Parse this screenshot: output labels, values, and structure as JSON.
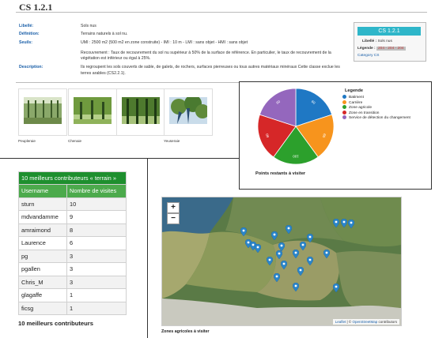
{
  "header": {
    "title": "CS 1.2.1"
  },
  "details": {
    "libelle_label": "Libellé:",
    "libelle_value": "Sols nus",
    "definition_label": "Définition:",
    "definition_value": "Terrains naturels à sol nu.",
    "seuils_label": "Seuils:",
    "seuils_line1": "UMI : 2500 m2 (500 m2 en zone construite) - IMI : 10 m - LMI : sans objet - HMI : sans objet",
    "seuils_line2": "Recouvrement : Taux de recouvrement du sol nu supérieur à 50% de la surface de référence. En particulier, le taux de recouvrement de la végétation est inférieur ou égal à 25%.",
    "description_label": "Description:",
    "description_value": "Ils regroupent les sols couverts de sable, de galets, de rochers, surfaces pierreuses ou tous autres matériaux minéraux Cette classe exclue les terres arables (CS2.2.1)."
  },
  "side_card": {
    "code": "CS 1.2.1",
    "libelle_label": "Libellé :",
    "libelle_value": "Sols nus",
    "legende_label": "Légende :",
    "legende_value": "204 - 204 - 204",
    "category_link": "Category CS"
  },
  "photos": [
    {
      "caption": "Peupleraie",
      "palette": [
        "#3c5a28",
        "#8aa86a",
        "#d9e4c8"
      ]
    },
    {
      "caption": "Chenaie",
      "palette": [
        "#2c4a1e",
        "#6f9a3e",
        "#b5d08a"
      ]
    },
    {
      "caption": "",
      "palette": [
        "#1e3a14",
        "#4e7a2e",
        "#a6c27a"
      ]
    },
    {
      "caption": "Yeuseraie",
      "palette": [
        "#2a4c70",
        "#5f8a3a",
        "#c9dcea"
      ]
    }
  ],
  "pie_card": {
    "legend_title": "Legende",
    "caption": "Points restants à visiter",
    "slices": [
      {
        "label": "Batiment",
        "value": 60,
        "color": "#1f78c4"
      },
      {
        "label": "Carrière",
        "value": 60,
        "color": "#f7941d"
      },
      {
        "label": "Zone agricole",
        "value": 60,
        "color": "#2ca02c"
      },
      {
        "label": "Zone en transition",
        "value": 60,
        "color": "#d62728"
      },
      {
        "label": "Service de détection du changement",
        "value": 60,
        "color": "#9467bd"
      }
    ],
    "slice_labels": [
      "60",
      "60",
      "100",
      "60",
      "60"
    ]
  },
  "contributors": {
    "caption": "10 meilleurs contributeurs « terrain »",
    "col_user": "Username",
    "col_visits": "Nombre de visites",
    "rows": [
      {
        "user": "sturn",
        "visits": "10"
      },
      {
        "user": "mdvandamme",
        "visits": "9"
      },
      {
        "user": "amraimond",
        "visits": "8"
      },
      {
        "user": "Laurence",
        "visits": "6"
      },
      {
        "user": "pg",
        "visits": "3"
      },
      {
        "user": "pgallen",
        "visits": "3"
      },
      {
        "user": "Chris_M",
        "visits": "3"
      },
      {
        "user": "glagaffe",
        "visits": "1"
      },
      {
        "user": "ficsg",
        "visits": "1"
      }
    ],
    "footer": "10 meilleurs contributeurs"
  },
  "map": {
    "zoom_in": "+",
    "zoom_out": "−",
    "attrib_link1": "Leaflet",
    "attrib_sep": " | © ",
    "attrib_link2": "OpenStreetMap",
    "attrib_tail": " contributors",
    "caption": "Zones agricoles à visiter",
    "marker_icon": "map-pin-icon",
    "markers": [
      {
        "lon": 0.62,
        "lat": 0.52
      },
      {
        "lon": 0.34,
        "lat": 0.29
      },
      {
        "lon": 0.36,
        "lat": 0.38
      },
      {
        "lon": 0.38,
        "lat": 0.4
      },
      {
        "lon": 0.4,
        "lat": 0.42
      },
      {
        "lon": 0.47,
        "lat": 0.32
      },
      {
        "lon": 0.53,
        "lat": 0.27
      },
      {
        "lon": 0.5,
        "lat": 0.41
      },
      {
        "lon": 0.49,
        "lat": 0.47
      },
      {
        "lon": 0.45,
        "lat": 0.52
      },
      {
        "lon": 0.51,
        "lat": 0.55
      },
      {
        "lon": 0.56,
        "lat": 0.46
      },
      {
        "lon": 0.59,
        "lat": 0.4
      },
      {
        "lon": 0.62,
        "lat": 0.34
      },
      {
        "lon": 0.69,
        "lat": 0.46
      },
      {
        "lon": 0.58,
        "lat": 0.6
      },
      {
        "lon": 0.48,
        "lat": 0.65
      },
      {
        "lon": 0.56,
        "lat": 0.72
      },
      {
        "lon": 0.73,
        "lat": 0.73
      },
      {
        "lon": 0.76,
        "lat": 0.22
      },
      {
        "lon": 0.73,
        "lat": 0.22
      },
      {
        "lon": 0.79,
        "lat": 0.23
      }
    ]
  }
}
